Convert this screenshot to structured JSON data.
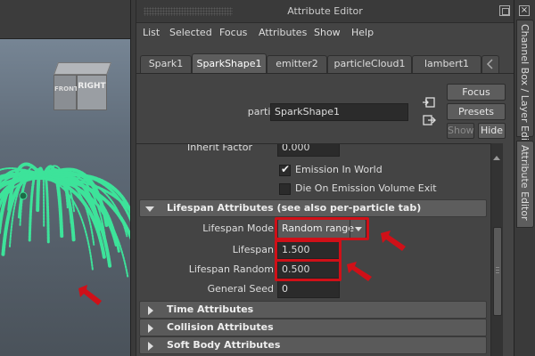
{
  "window": {
    "title": "Attribute Editor"
  },
  "viewport": {
    "viewcube": {
      "front_label": "FRONT",
      "right_label": "RIGHT"
    }
  },
  "menu": {
    "items": [
      "List",
      "Selected",
      "Focus",
      "Attributes",
      "Show",
      "Help"
    ]
  },
  "tabs": [
    {
      "label": "Spark1",
      "active": false
    },
    {
      "label": "SparkShape1",
      "active": true
    },
    {
      "label": "emitter2",
      "active": false
    },
    {
      "label": "particleCloud1",
      "active": false
    },
    {
      "label": "lambert1",
      "active": false
    }
  ],
  "node": {
    "label": "particle:",
    "value": "SparkShape1"
  },
  "buttons": {
    "focus": "Focus",
    "presets": "Presets",
    "show": "Show",
    "hide": "Hide"
  },
  "attributes": {
    "inherit_factor_label": "Inherit Factor",
    "inherit_factor_value": "0.000",
    "emission_in_world": {
      "label": "Emission In World",
      "checked": true
    },
    "die_on_emission_volume_exit": {
      "label": "Die On Emission Volume Exit",
      "checked": false
    },
    "lifespan_section": {
      "title": "Lifespan Attributes (see also per-particle tab)"
    },
    "lifespan_mode": {
      "label": "Lifespan Mode",
      "value": "Random range"
    },
    "lifespan": {
      "label": "Lifespan",
      "value": "1.500"
    },
    "lifespan_random": {
      "label": "Lifespan Random",
      "value": "0.500"
    },
    "general_seed": {
      "label": "General Seed",
      "value": "0"
    },
    "closed_sections": [
      "Time Attributes",
      "Collision Attributes",
      "Soft Body Attributes"
    ]
  },
  "dock": {
    "tabs": [
      "Channel Box / Layer Editor",
      "Attribute Editor"
    ],
    "close_glyph": "×"
  },
  "colors": {
    "particles": "#3de39a",
    "highlight": "#d01018",
    "panel_bg": "#444444"
  }
}
